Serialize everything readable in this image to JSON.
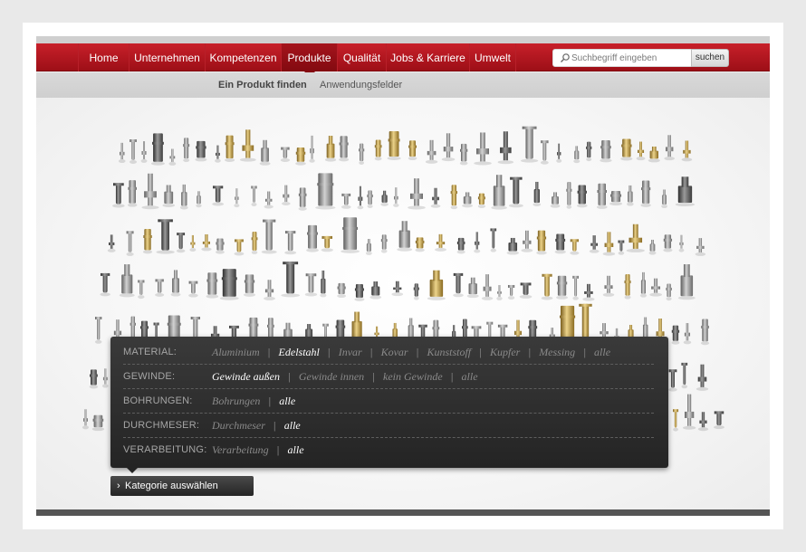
{
  "nav": {
    "items": [
      {
        "label": "Home",
        "active": false
      },
      {
        "label": "Unternehmen",
        "active": false
      },
      {
        "label": "Kompetenzen",
        "active": false
      },
      {
        "label": "Produkte",
        "active": true
      },
      {
        "label": "Qualität",
        "active": false
      },
      {
        "label": "Jobs & Karriere",
        "active": false
      },
      {
        "label": "Umwelt",
        "active": false
      }
    ]
  },
  "search": {
    "placeholder": "Suchbegriff eingeben",
    "button_label": "suchen",
    "icon": "search-icon"
  },
  "subnav": {
    "items": [
      {
        "label": "Ein Produkt finden",
        "active": true
      },
      {
        "label": "Anwendungsfelder",
        "active": false
      }
    ]
  },
  "filters": [
    {
      "label": "MATERIAL:",
      "options": [
        {
          "label": "Aluminium",
          "selected": false
        },
        {
          "label": "Edelstahl",
          "selected": true
        },
        {
          "label": "Invar",
          "selected": false
        },
        {
          "label": "Kovar",
          "selected": false
        },
        {
          "label": "Kunststoff",
          "selected": false
        },
        {
          "label": "Kupfer",
          "selected": false
        },
        {
          "label": "Messing",
          "selected": false
        },
        {
          "label": "alle",
          "selected": false
        }
      ]
    },
    {
      "label": "GEWINDE:",
      "options": [
        {
          "label": "Gewinde außen",
          "selected": true
        },
        {
          "label": "Gewinde innen",
          "selected": false
        },
        {
          "label": "kein Gewinde",
          "selected": false
        },
        {
          "label": "alle",
          "selected": false
        }
      ]
    },
    {
      "label": "BOHRUNGEN:",
      "options": [
        {
          "label": "Bohrungen",
          "selected": false
        },
        {
          "label": "alle",
          "selected": true
        }
      ]
    },
    {
      "label": "DURCHMESER:",
      "options": [
        {
          "label": "Durchmeser",
          "selected": false
        },
        {
          "label": "alle",
          "selected": true
        }
      ]
    },
    {
      "label": "VERARBEITUNG:",
      "options": [
        {
          "label": "Verarbeitung",
          "selected": false
        },
        {
          "label": "alle",
          "selected": true
        }
      ]
    }
  ],
  "category_button": {
    "label": "Kategorie auswählen",
    "icon": "chevron-right-icon"
  },
  "colors": {
    "brand_red": "#b3161f",
    "brass": "#c9a94a",
    "steel": "#8c8c8c"
  }
}
